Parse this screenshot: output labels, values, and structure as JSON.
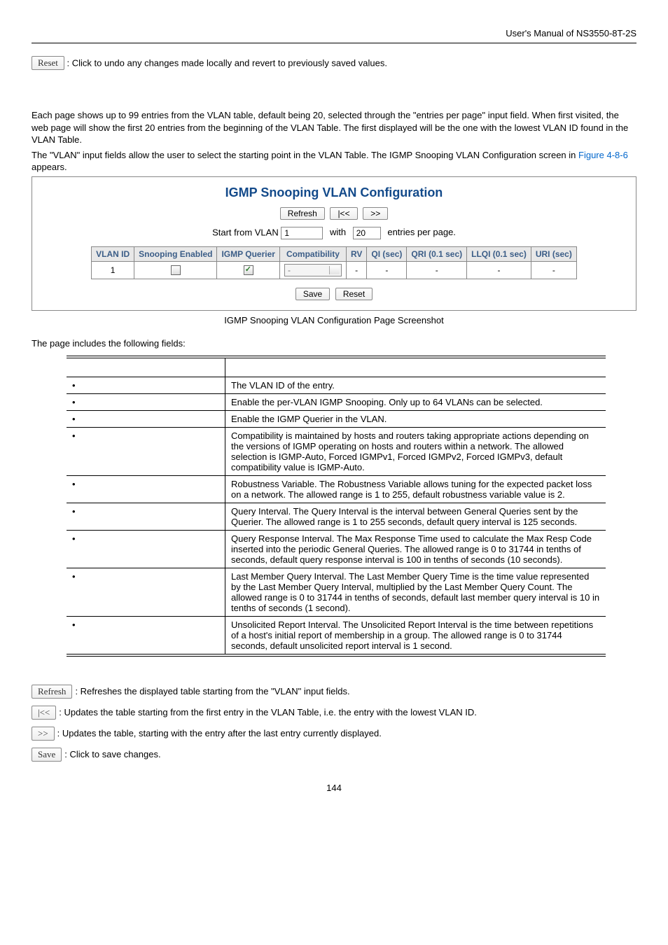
{
  "header": {
    "manual_title": "User's Manual of NS3550-8T-2S"
  },
  "top_reset": {
    "btn": "Reset",
    "desc": ": Click to undo any changes made locally and revert to previously saved values."
  },
  "intro": {
    "p1": "Each page shows up to 99 entries from the VLAN table, default being 20, selected through the \"entries per page\" input field. When first visited, the web page will show the first 20 entries from the beginning of the VLAN Table. The first displayed will be the one with the lowest VLAN ID found in the VLAN Table.",
    "p2a": "The \"VLAN\" input fields allow the user to select the starting point in the VLAN Table. The IGMP Snooping VLAN Configuration screen in ",
    "p2link": "Figure 4-8-6",
    "p2b": " appears."
  },
  "panel": {
    "title": "IGMP Snooping VLAN Configuration",
    "buttons": {
      "refresh": "Refresh",
      "first": "|<<",
      "next": ">>"
    },
    "paging": {
      "start_label": "Start from VLAN",
      "start_value": "1",
      "with_label": "with",
      "with_value": "20",
      "entries_label": "entries per page."
    },
    "cols": {
      "vlan_id": "VLAN ID",
      "snoop": "Snooping Enabled",
      "querier": "IGMP Querier",
      "compat": "Compatibility",
      "rv": "RV",
      "qi": "QI (sec)",
      "qri": "QRI (0.1 sec)",
      "llqi": "LLQI (0.1 sec)",
      "uri": "URI (sec)"
    },
    "row": {
      "vlan_id": "1",
      "snoop_checked": false,
      "querier_checked": true,
      "compat": "-",
      "rv": "-",
      "qi": "-",
      "qri": "-",
      "llqi": "-",
      "uri": "-"
    },
    "save": "Save",
    "reset": "Reset"
  },
  "caption": "IGMP Snooping VLAN Configuration Page Screenshot",
  "fields_intro": "The page includes the following fields:",
  "fields": [
    {
      "desc": "The VLAN ID of the entry."
    },
    {
      "desc": "Enable the per-VLAN IGMP Snooping. Only up to 64 VLANs can be selected."
    },
    {
      "desc": "Enable the IGMP Querier in the VLAN."
    },
    {
      "desc": "Compatibility is maintained by hosts and routers taking appropriate actions depending on the versions of IGMP operating on hosts and routers within a network. The allowed selection is IGMP-Auto, Forced IGMPv1, Forced IGMPv2, Forced IGMPv3, default compatibility value is IGMP-Auto."
    },
    {
      "desc": "Robustness Variable. The Robustness Variable allows tuning for the expected packet loss on a network. The allowed range is 1 to 255, default robustness variable value is 2."
    },
    {
      "desc": "Query Interval. The Query Interval is the interval between General Queries sent by the Querier. The allowed range is 1 to 255 seconds, default query interval is 125 seconds."
    },
    {
      "desc": "Query Response Interval. The Max Response Time used to calculate the Max Resp Code inserted into the periodic General Queries. The allowed range is 0 to 31744 in tenths of seconds, default query response interval is 100 in tenths of seconds (10 seconds)."
    },
    {
      "desc": "Last Member Query Interval. The Last Member Query Time is the time value represented by the Last Member Query Interval, multiplied by the Last Member Query Count. The allowed range is 0 to 31744 in tenths of seconds, default last member query interval is 10 in tenths of seconds (1 second)."
    },
    {
      "desc": "Unsolicited Report Interval. The Unsolicited Report Interval is the time between repetitions of a host's initial report of membership in a group. The allowed range is 0 to 31744 seconds, default unsolicited report interval is 1 second."
    }
  ],
  "footer": {
    "refresh": {
      "btn": "Refresh",
      "txt": ": Refreshes the displayed table starting from the \"VLAN\" input fields."
    },
    "first": {
      "btn": "|<<",
      "txt": ": Updates the table starting from the first entry in the VLAN Table, i.e. the entry with the lowest VLAN ID."
    },
    "next": {
      "btn": ">>",
      "txt": ": Updates the table, starting with the entry after the last entry currently displayed."
    },
    "save": {
      "btn": "Save",
      "txt": ": Click to save changes."
    }
  },
  "page_number": "144"
}
